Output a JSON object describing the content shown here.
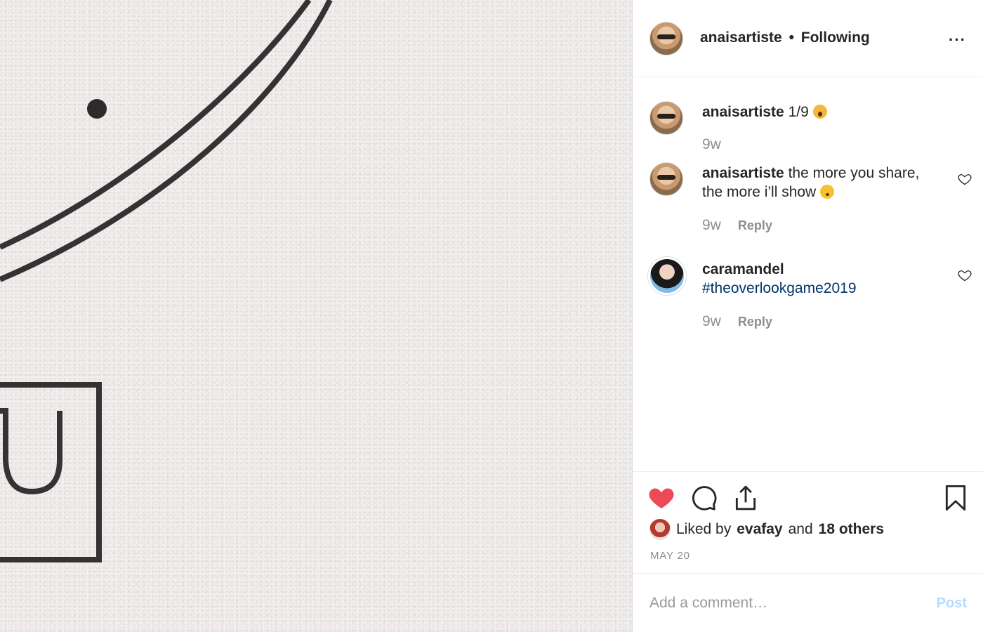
{
  "post": {
    "header": {
      "username": "anaisartiste",
      "separator": "•",
      "follow_status": "Following",
      "more_icon": "more-horizontal-icon",
      "more_label": "···"
    },
    "comments": [
      {
        "username": "anaisartiste",
        "text": "1/9",
        "emoji": "face-screaming-in-fear",
        "time": "9w",
        "reply_label": "",
        "likeable": false
      },
      {
        "username": "anaisartiste",
        "text": "the more you share, the more i’ll show",
        "emoji": "shushing-face",
        "time": "9w",
        "reply_label": "Reply",
        "likeable": true
      },
      {
        "username": "caramandel",
        "hashtag": "#theoverlookgame2019",
        "time": "9w",
        "reply_label": "Reply",
        "likeable": true
      }
    ],
    "actions": {
      "like_icon": "heart-filled-icon",
      "comment_icon": "comment-bubble-icon",
      "share_icon": "share-upload-icon",
      "save_icon": "bookmark-icon",
      "like_color": "#ed4956"
    },
    "likes": {
      "prefix": "Liked by",
      "liker": "evafay",
      "and": "and",
      "others": "18 others"
    },
    "date": "MAY 20",
    "add_comment": {
      "placeholder": "Add a comment…",
      "value": "",
      "post_label": "Post",
      "post_color": "#b3dbff"
    }
  }
}
